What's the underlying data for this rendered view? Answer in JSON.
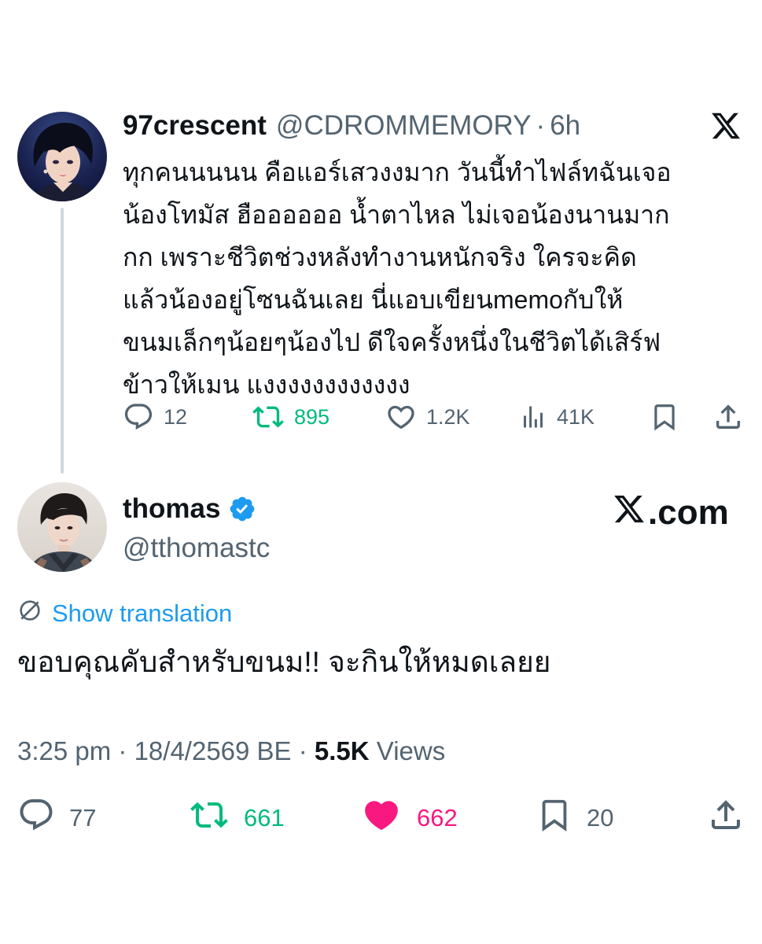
{
  "parent_tweet": {
    "display_name": "97crescent",
    "handle": "@CDROMMEMORY",
    "separator": "·",
    "time": "6h",
    "text": "ทุกคนนนนน คือแอร์เสวงงมาก วันนี้ทำไฟล์ทฉันเจอ\nน้องโทมัส ฮืออออออ น้ำตาไหล ไม่เจอน้องนานมาก\nกก เพราะชีวิตช่วงหลังทำงานหนักจริง ใครจะคิด\nแล้วน้องอยู่โซนฉันเลย นี่แอบเขียนmemoกับให้\nขนมเล็กๆน้อยๆน้องไป ดีใจครั้งหนึ่งในชีวิตได้เสิร์ฟ\nข้าวให้เมน แงงงงงงงงงงงง",
    "replies": "12",
    "reposts": "895",
    "likes": "1.2K",
    "views": "41K",
    "icons": [
      "x-logo",
      "reply-icon",
      "repost-icon",
      "like-icon",
      "views-icon",
      "bookmark-icon",
      "share-icon"
    ]
  },
  "main_tweet": {
    "display_name": "thomas",
    "handle": "@tthomastc",
    "verified": true,
    "source_mark": ".com",
    "translate_label": "Show translation",
    "text": "ขอบคุณคับสำหรับขนม!! จะกินให้หมดเลยย",
    "timestamp": "3:25 pm · 18/4/2569 BE · ",
    "views_count": "5.5K",
    "views_label": " Views",
    "replies": "77",
    "reposts": "661",
    "likes": "662",
    "bookmarks": "20"
  },
  "colors": {
    "text_primary": "#0f1419",
    "text_secondary": "#536471",
    "link_blue": "#1d9bf0",
    "repost_green": "#00ba7c",
    "like_pink": "#f91880",
    "thread_line": "#cfd9de"
  }
}
